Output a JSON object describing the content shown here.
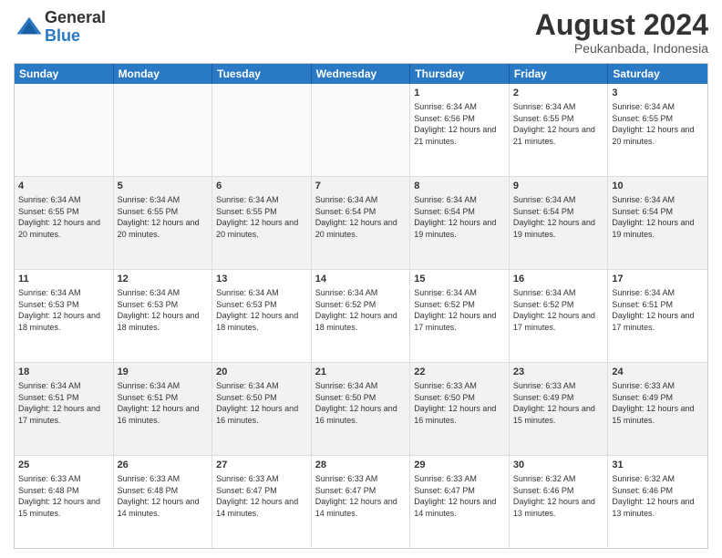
{
  "logo": {
    "general": "General",
    "blue": "Blue"
  },
  "title": {
    "month_year": "August 2024",
    "location": "Peukanbada, Indonesia"
  },
  "calendar": {
    "headers": [
      "Sunday",
      "Monday",
      "Tuesday",
      "Wednesday",
      "Thursday",
      "Friday",
      "Saturday"
    ],
    "rows": [
      [
        {
          "day": "",
          "empty": true
        },
        {
          "day": "",
          "empty": true
        },
        {
          "day": "",
          "empty": true
        },
        {
          "day": "",
          "empty": true
        },
        {
          "day": "1",
          "sunrise": "Sunrise: 6:34 AM",
          "sunset": "Sunset: 6:56 PM",
          "daylight": "Daylight: 12 hours and 21 minutes."
        },
        {
          "day": "2",
          "sunrise": "Sunrise: 6:34 AM",
          "sunset": "Sunset: 6:55 PM",
          "daylight": "Daylight: 12 hours and 21 minutes."
        },
        {
          "day": "3",
          "sunrise": "Sunrise: 6:34 AM",
          "sunset": "Sunset: 6:55 PM",
          "daylight": "Daylight: 12 hours and 20 minutes."
        }
      ],
      [
        {
          "day": "4",
          "sunrise": "Sunrise: 6:34 AM",
          "sunset": "Sunset: 6:55 PM",
          "daylight": "Daylight: 12 hours and 20 minutes."
        },
        {
          "day": "5",
          "sunrise": "Sunrise: 6:34 AM",
          "sunset": "Sunset: 6:55 PM",
          "daylight": "Daylight: 12 hours and 20 minutes."
        },
        {
          "day": "6",
          "sunrise": "Sunrise: 6:34 AM",
          "sunset": "Sunset: 6:55 PM",
          "daylight": "Daylight: 12 hours and 20 minutes."
        },
        {
          "day": "7",
          "sunrise": "Sunrise: 6:34 AM",
          "sunset": "Sunset: 6:54 PM",
          "daylight": "Daylight: 12 hours and 20 minutes."
        },
        {
          "day": "8",
          "sunrise": "Sunrise: 6:34 AM",
          "sunset": "Sunset: 6:54 PM",
          "daylight": "Daylight: 12 hours and 19 minutes."
        },
        {
          "day": "9",
          "sunrise": "Sunrise: 6:34 AM",
          "sunset": "Sunset: 6:54 PM",
          "daylight": "Daylight: 12 hours and 19 minutes."
        },
        {
          "day": "10",
          "sunrise": "Sunrise: 6:34 AM",
          "sunset": "Sunset: 6:54 PM",
          "daylight": "Daylight: 12 hours and 19 minutes."
        }
      ],
      [
        {
          "day": "11",
          "sunrise": "Sunrise: 6:34 AM",
          "sunset": "Sunset: 6:53 PM",
          "daylight": "Daylight: 12 hours and 18 minutes."
        },
        {
          "day": "12",
          "sunrise": "Sunrise: 6:34 AM",
          "sunset": "Sunset: 6:53 PM",
          "daylight": "Daylight: 12 hours and 18 minutes."
        },
        {
          "day": "13",
          "sunrise": "Sunrise: 6:34 AM",
          "sunset": "Sunset: 6:53 PM",
          "daylight": "Daylight: 12 hours and 18 minutes."
        },
        {
          "day": "14",
          "sunrise": "Sunrise: 6:34 AM",
          "sunset": "Sunset: 6:52 PM",
          "daylight": "Daylight: 12 hours and 18 minutes."
        },
        {
          "day": "15",
          "sunrise": "Sunrise: 6:34 AM",
          "sunset": "Sunset: 6:52 PM",
          "daylight": "Daylight: 12 hours and 17 minutes."
        },
        {
          "day": "16",
          "sunrise": "Sunrise: 6:34 AM",
          "sunset": "Sunset: 6:52 PM",
          "daylight": "Daylight: 12 hours and 17 minutes."
        },
        {
          "day": "17",
          "sunrise": "Sunrise: 6:34 AM",
          "sunset": "Sunset: 6:51 PM",
          "daylight": "Daylight: 12 hours and 17 minutes."
        }
      ],
      [
        {
          "day": "18",
          "sunrise": "Sunrise: 6:34 AM",
          "sunset": "Sunset: 6:51 PM",
          "daylight": "Daylight: 12 hours and 17 minutes."
        },
        {
          "day": "19",
          "sunrise": "Sunrise: 6:34 AM",
          "sunset": "Sunset: 6:51 PM",
          "daylight": "Daylight: 12 hours and 16 minutes."
        },
        {
          "day": "20",
          "sunrise": "Sunrise: 6:34 AM",
          "sunset": "Sunset: 6:50 PM",
          "daylight": "Daylight: 12 hours and 16 minutes."
        },
        {
          "day": "21",
          "sunrise": "Sunrise: 6:34 AM",
          "sunset": "Sunset: 6:50 PM",
          "daylight": "Daylight: 12 hours and 16 minutes."
        },
        {
          "day": "22",
          "sunrise": "Sunrise: 6:33 AM",
          "sunset": "Sunset: 6:50 PM",
          "daylight": "Daylight: 12 hours and 16 minutes."
        },
        {
          "day": "23",
          "sunrise": "Sunrise: 6:33 AM",
          "sunset": "Sunset: 6:49 PM",
          "daylight": "Daylight: 12 hours and 15 minutes."
        },
        {
          "day": "24",
          "sunrise": "Sunrise: 6:33 AM",
          "sunset": "Sunset: 6:49 PM",
          "daylight": "Daylight: 12 hours and 15 minutes."
        }
      ],
      [
        {
          "day": "25",
          "sunrise": "Sunrise: 6:33 AM",
          "sunset": "Sunset: 6:48 PM",
          "daylight": "Daylight: 12 hours and 15 minutes."
        },
        {
          "day": "26",
          "sunrise": "Sunrise: 6:33 AM",
          "sunset": "Sunset: 6:48 PM",
          "daylight": "Daylight: 12 hours and 14 minutes."
        },
        {
          "day": "27",
          "sunrise": "Sunrise: 6:33 AM",
          "sunset": "Sunset: 6:47 PM",
          "daylight": "Daylight: 12 hours and 14 minutes."
        },
        {
          "day": "28",
          "sunrise": "Sunrise: 6:33 AM",
          "sunset": "Sunset: 6:47 PM",
          "daylight": "Daylight: 12 hours and 14 minutes."
        },
        {
          "day": "29",
          "sunrise": "Sunrise: 6:33 AM",
          "sunset": "Sunset: 6:47 PM",
          "daylight": "Daylight: 12 hours and 14 minutes."
        },
        {
          "day": "30",
          "sunrise": "Sunrise: 6:32 AM",
          "sunset": "Sunset: 6:46 PM",
          "daylight": "Daylight: 12 hours and 13 minutes."
        },
        {
          "day": "31",
          "sunrise": "Sunrise: 6:32 AM",
          "sunset": "Sunset: 6:46 PM",
          "daylight": "Daylight: 12 hours and 13 minutes."
        }
      ]
    ]
  }
}
